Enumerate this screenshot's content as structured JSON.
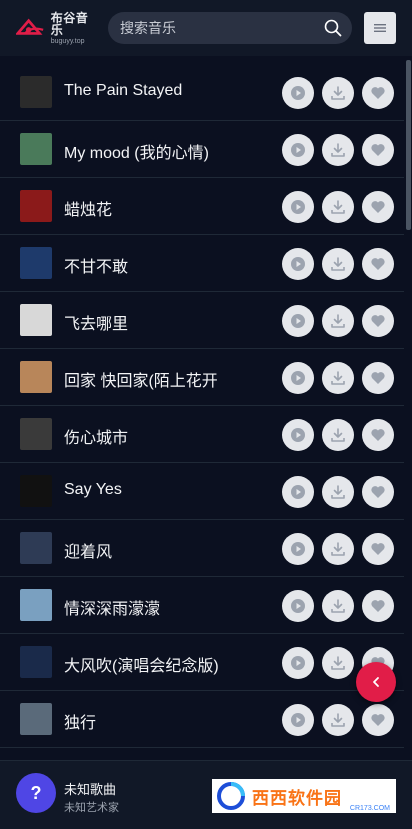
{
  "header": {
    "logo_name": "布谷音乐",
    "logo_domain": "buguyy.top",
    "search_placeholder": "搜索音乐",
    "menu_icon": "hamburger-icon"
  },
  "colors": {
    "accent": "#e11d48",
    "background": "#0b1020",
    "header": "#111827",
    "action_button": "#e5e7eb",
    "avatar": "#4f46e5"
  },
  "songs": [
    {
      "title": "The Pain Stayed"
    },
    {
      "title": "My mood (我的心情)"
    },
    {
      "title": "蜡烛花"
    },
    {
      "title": "不甘不敢"
    },
    {
      "title": "飞去哪里"
    },
    {
      "title": "回家 快回家(陌上花开"
    },
    {
      "title": "伤心城市"
    },
    {
      "title": "Say Yes"
    },
    {
      "title": "迎着风"
    },
    {
      "title": "情深深雨濛濛"
    },
    {
      "title": "大风吹(演唱会纪念版)"
    },
    {
      "title": "独行"
    }
  ],
  "actions": {
    "play_icon": "play-icon",
    "download_icon": "download-icon",
    "favorite_icon": "heart-icon"
  },
  "player": {
    "avatar_text": "?",
    "title": "未知歌曲",
    "artist": "未知艺术家"
  },
  "watermark": {
    "text": "西西软件园",
    "sub": "CR173.COM"
  }
}
